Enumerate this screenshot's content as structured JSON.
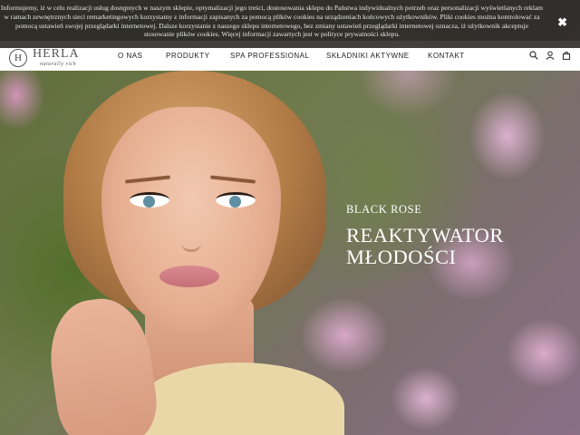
{
  "cookie_banner": {
    "text": "Informujemy, iż w celu realizacji usług dostępnych w naszym sklepie, optymalizacji jego treści, dostosowania sklepu do Państwa indywidualnych potrzeb oraz personalizacji wyświetlanych reklam w ramach zewnętrznych sieci remarketingowych korzystamy z informacji zapisanych za pomocą plików cookies na urządzeniach końcowych użytkowników. Pliki cookies można kontrolować za pomocą ustawień swojej przeglądarki internetowej. Dalsze korzystanie z naszego sklepu internetowego, bez zmiany ustawień przeglądarki internetowej oznacza, iż użytkownik akceptuje stosowanie plików cookies. Więcej informacji zawartych jest w polityce prywatności sklepu.",
    "close_label": "✖"
  },
  "header": {
    "logo_mark": "H",
    "logo_name": "HERLA",
    "logo_tagline": "naturally rich",
    "menu": [
      "O NAS",
      "PRODUKTY",
      "SPA PROFESSIONAL",
      "SKŁADNIKI AKTYWNE",
      "KONTAKT"
    ],
    "icons": [
      "search-icon",
      "user-icon",
      "cart-icon"
    ]
  },
  "hero": {
    "subtitle": "BLACK ROSE",
    "headline_line1": "REAKTYWATOR",
    "headline_line2": "MŁODOŚCI",
    "accent_color": "#ffffff"
  }
}
